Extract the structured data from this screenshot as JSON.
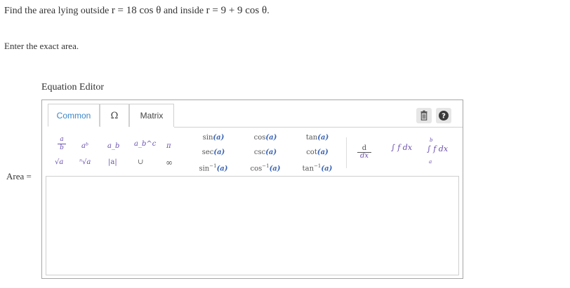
{
  "question": {
    "prefix": "Find the area lying outside ",
    "expr1": "r = 18 cos θ",
    "middle": " and inside ",
    "expr2": "r = 9 + 9 cos θ",
    "suffix": "."
  },
  "instruction": "Enter the exact area.",
  "editor": {
    "title": "Equation Editor",
    "tabs": [
      {
        "label": "Common",
        "active": true
      },
      {
        "label": "Ω",
        "active": false
      },
      {
        "label": "Matrix",
        "active": false
      }
    ],
    "symbols": {
      "fraction": "a/b",
      "power": "aᵇ",
      "subscript": "a_b",
      "subsup": "a_b^c",
      "pi": "π",
      "sqrt": "√a",
      "nroot": "ⁿ√a",
      "abs": "|a|",
      "union": "∪",
      "infinity": "∞"
    },
    "functions": {
      "sin": "sin",
      "sec": "sec",
      "arcsin": "sin",
      "cos": "cos",
      "csc": "csc",
      "arccos": "cos",
      "tan": "tan",
      "cot": "cot",
      "arctan": "tan",
      "arg": "(a)",
      "inv": "−1"
    },
    "calculus": {
      "derivative_top": "d",
      "derivative_bottom": "dx",
      "integral": "∫ f dx",
      "def_integral": "∫ f dx",
      "upper": "b",
      "lower": "a"
    }
  },
  "answer": {
    "label": "Area =",
    "value": ""
  }
}
